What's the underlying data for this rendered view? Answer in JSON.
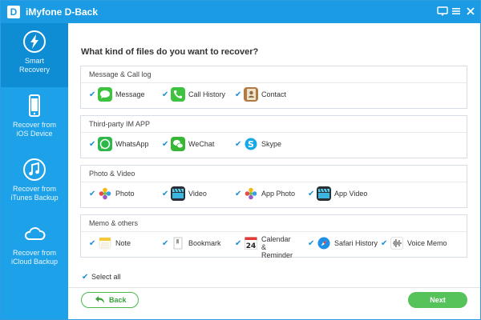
{
  "window": {
    "title": "iMyfone D-Back",
    "logo_letter": "D"
  },
  "sidebar": {
    "items": [
      {
        "label": "Smart\nRecovery",
        "icon": "lightning-icon"
      },
      {
        "label": "Recover from\niOS Device",
        "icon": "phone-icon"
      },
      {
        "label": "Recover from\niTunes Backup",
        "icon": "music-note-icon"
      },
      {
        "label": "Recover from\niCloud Backup",
        "icon": "cloud-icon"
      }
    ]
  },
  "main": {
    "question": "What kind of files do you want to recover?",
    "groups": [
      {
        "title": "Message & Call log",
        "items": [
          {
            "label": "Message"
          },
          {
            "label": "Call History"
          },
          {
            "label": "Contact"
          }
        ]
      },
      {
        "title": "Third-party IM APP",
        "items": [
          {
            "label": "WhatsApp"
          },
          {
            "label": "WeChat"
          },
          {
            "label": "Skype"
          }
        ]
      },
      {
        "title": "Photo & Video",
        "items": [
          {
            "label": "Photo"
          },
          {
            "label": "Video"
          },
          {
            "label": "App Photo"
          },
          {
            "label": "App Video"
          }
        ]
      },
      {
        "title": "Memo & others",
        "items": [
          {
            "label": "Note"
          },
          {
            "label": "Bookmark"
          },
          {
            "label": "Calendar &\nReminder"
          },
          {
            "label": "Safari History"
          },
          {
            "label": "Voice Memo"
          }
        ]
      }
    ],
    "select_all": "Select all",
    "checkmark": "✔",
    "calendar_day": "24"
  },
  "footer": {
    "back_label": "Back",
    "next_label": "Next"
  },
  "colors": {
    "titlebar": "#1a9be3",
    "sidebar": "#1da1e8",
    "sidebar_active": "#0e8cd4",
    "next": "#55c25a",
    "back_border": "#4cb84c"
  }
}
